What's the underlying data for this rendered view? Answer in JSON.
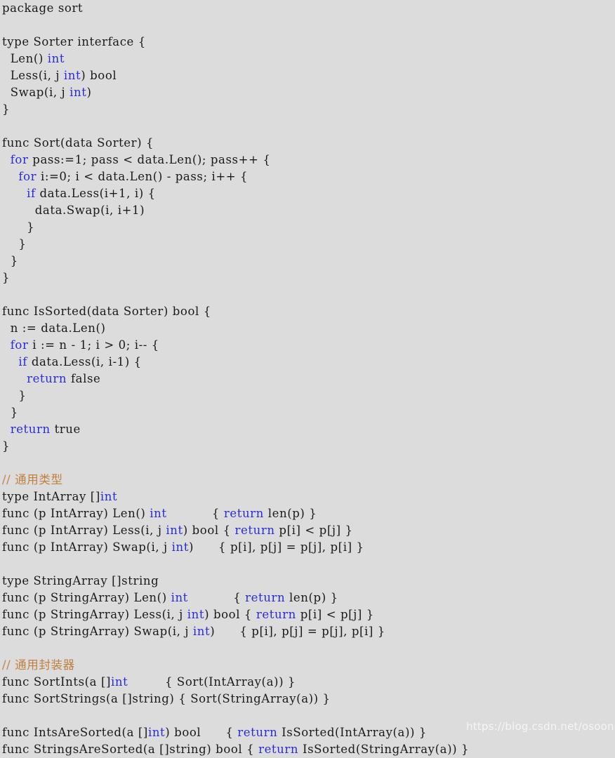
{
  "document": {
    "language": "go",
    "background_color": "#dcdcdc",
    "text_color": "#1a1a1a",
    "keyword_color": "#2b2bd6",
    "comment_color": "#c08040"
  },
  "watermark": {
    "text": "https://blog.csdn.net/osoon"
  },
  "lines": [
    [
      {
        "t": "plain",
        "s": "package sort"
      }
    ],
    [
      {
        "t": "plain",
        "s": ""
      }
    ],
    [
      {
        "t": "plain",
        "s": "type Sorter interface {"
      }
    ],
    [
      {
        "t": "plain",
        "s": "  Len() "
      },
      {
        "t": "keyword",
        "s": "int"
      }
    ],
    [
      {
        "t": "plain",
        "s": "  Less(i, j "
      },
      {
        "t": "keyword",
        "s": "int"
      },
      {
        "t": "plain",
        "s": ") bool"
      }
    ],
    [
      {
        "t": "plain",
        "s": "  Swap(i, j "
      },
      {
        "t": "keyword",
        "s": "int"
      },
      {
        "t": "plain",
        "s": ")"
      }
    ],
    [
      {
        "t": "plain",
        "s": "}"
      }
    ],
    [
      {
        "t": "plain",
        "s": ""
      }
    ],
    [
      {
        "t": "plain",
        "s": "func Sort(data Sorter) {"
      }
    ],
    [
      {
        "t": "plain",
        "s": "  "
      },
      {
        "t": "keyword",
        "s": "for"
      },
      {
        "t": "plain",
        "s": " pass:=1; pass < data.Len(); pass++ {"
      }
    ],
    [
      {
        "t": "plain",
        "s": "    "
      },
      {
        "t": "keyword",
        "s": "for"
      },
      {
        "t": "plain",
        "s": " i:=0; i < data.Len() - pass; i++ {"
      }
    ],
    [
      {
        "t": "plain",
        "s": "      "
      },
      {
        "t": "keyword",
        "s": "if"
      },
      {
        "t": "plain",
        "s": " data.Less(i+1, i) {"
      }
    ],
    [
      {
        "t": "plain",
        "s": "        data.Swap(i, i+1)"
      }
    ],
    [
      {
        "t": "plain",
        "s": "      }"
      }
    ],
    [
      {
        "t": "plain",
        "s": "    }"
      }
    ],
    [
      {
        "t": "plain",
        "s": "  }"
      }
    ],
    [
      {
        "t": "plain",
        "s": "}"
      }
    ],
    [
      {
        "t": "plain",
        "s": ""
      }
    ],
    [
      {
        "t": "plain",
        "s": "func IsSorted(data Sorter) bool {"
      }
    ],
    [
      {
        "t": "plain",
        "s": "  n := data.Len()"
      }
    ],
    [
      {
        "t": "plain",
        "s": "  "
      },
      {
        "t": "keyword",
        "s": "for"
      },
      {
        "t": "plain",
        "s": " i := n - 1; i > 0; i-- {"
      }
    ],
    [
      {
        "t": "plain",
        "s": "    "
      },
      {
        "t": "keyword",
        "s": "if"
      },
      {
        "t": "plain",
        "s": " data.Less(i, i-1) {"
      }
    ],
    [
      {
        "t": "plain",
        "s": "      "
      },
      {
        "t": "keyword",
        "s": "return"
      },
      {
        "t": "plain",
        "s": " false"
      }
    ],
    [
      {
        "t": "plain",
        "s": "    }"
      }
    ],
    [
      {
        "t": "plain",
        "s": "  }"
      }
    ],
    [
      {
        "t": "plain",
        "s": "  "
      },
      {
        "t": "keyword",
        "s": "return"
      },
      {
        "t": "plain",
        "s": " true"
      }
    ],
    [
      {
        "t": "plain",
        "s": "}"
      }
    ],
    [
      {
        "t": "plain",
        "s": ""
      }
    ],
    [
      {
        "t": "comment",
        "s": "// 通用类型"
      }
    ],
    [
      {
        "t": "plain",
        "s": "type IntArray []"
      },
      {
        "t": "keyword",
        "s": "int"
      }
    ],
    [
      {
        "t": "plain",
        "s": "func (p IntArray) Len() "
      },
      {
        "t": "keyword",
        "s": "int"
      },
      {
        "t": "plain",
        "s": "           { "
      },
      {
        "t": "keyword",
        "s": "return"
      },
      {
        "t": "plain",
        "s": " len(p) }"
      }
    ],
    [
      {
        "t": "plain",
        "s": "func (p IntArray) Less(i, j "
      },
      {
        "t": "keyword",
        "s": "int"
      },
      {
        "t": "plain",
        "s": ") bool { "
      },
      {
        "t": "keyword",
        "s": "return"
      },
      {
        "t": "plain",
        "s": " p[i] < p[j] }"
      }
    ],
    [
      {
        "t": "plain",
        "s": "func (p IntArray) Swap(i, j "
      },
      {
        "t": "keyword",
        "s": "int"
      },
      {
        "t": "plain",
        "s": ")      { p[i], p[j] = p[j], p[i] }"
      }
    ],
    [
      {
        "t": "plain",
        "s": ""
      }
    ],
    [
      {
        "t": "plain",
        "s": "type StringArray []string"
      }
    ],
    [
      {
        "t": "plain",
        "s": "func (p StringArray) Len() "
      },
      {
        "t": "keyword",
        "s": "int"
      },
      {
        "t": "plain",
        "s": "           { "
      },
      {
        "t": "keyword",
        "s": "return"
      },
      {
        "t": "plain",
        "s": " len(p) }"
      }
    ],
    [
      {
        "t": "plain",
        "s": "func (p StringArray) Less(i, j "
      },
      {
        "t": "keyword",
        "s": "int"
      },
      {
        "t": "plain",
        "s": ") bool { "
      },
      {
        "t": "keyword",
        "s": "return"
      },
      {
        "t": "plain",
        "s": " p[i] < p[j] }"
      }
    ],
    [
      {
        "t": "plain",
        "s": "func (p StringArray) Swap(i, j "
      },
      {
        "t": "keyword",
        "s": "int"
      },
      {
        "t": "plain",
        "s": ")      { p[i], p[j] = p[j], p[i] }"
      }
    ],
    [
      {
        "t": "plain",
        "s": ""
      }
    ],
    [
      {
        "t": "comment",
        "s": "// 通用封装器"
      }
    ],
    [
      {
        "t": "plain",
        "s": "func SortInts(a []"
      },
      {
        "t": "keyword",
        "s": "int"
      },
      {
        "t": "plain",
        "s": "         { Sort(IntArray(a)) }"
      }
    ],
    [
      {
        "t": "plain",
        "s": "func SortStrings(a []string) { Sort(StringArray(a)) }"
      }
    ],
    [
      {
        "t": "plain",
        "s": ""
      }
    ],
    [
      {
        "t": "plain",
        "s": "func IntsAreSorted(a []"
      },
      {
        "t": "keyword",
        "s": "int"
      },
      {
        "t": "plain",
        "s": ") bool      { "
      },
      {
        "t": "keyword",
        "s": "return"
      },
      {
        "t": "plain",
        "s": " IsSorted(IntArray(a)) }"
      }
    ],
    [
      {
        "t": "plain",
        "s": "func StringsAreSorted(a []string) bool { "
      },
      {
        "t": "keyword",
        "s": "return"
      },
      {
        "t": "plain",
        "s": " IsSorted(StringArray(a)) }"
      }
    ]
  ]
}
